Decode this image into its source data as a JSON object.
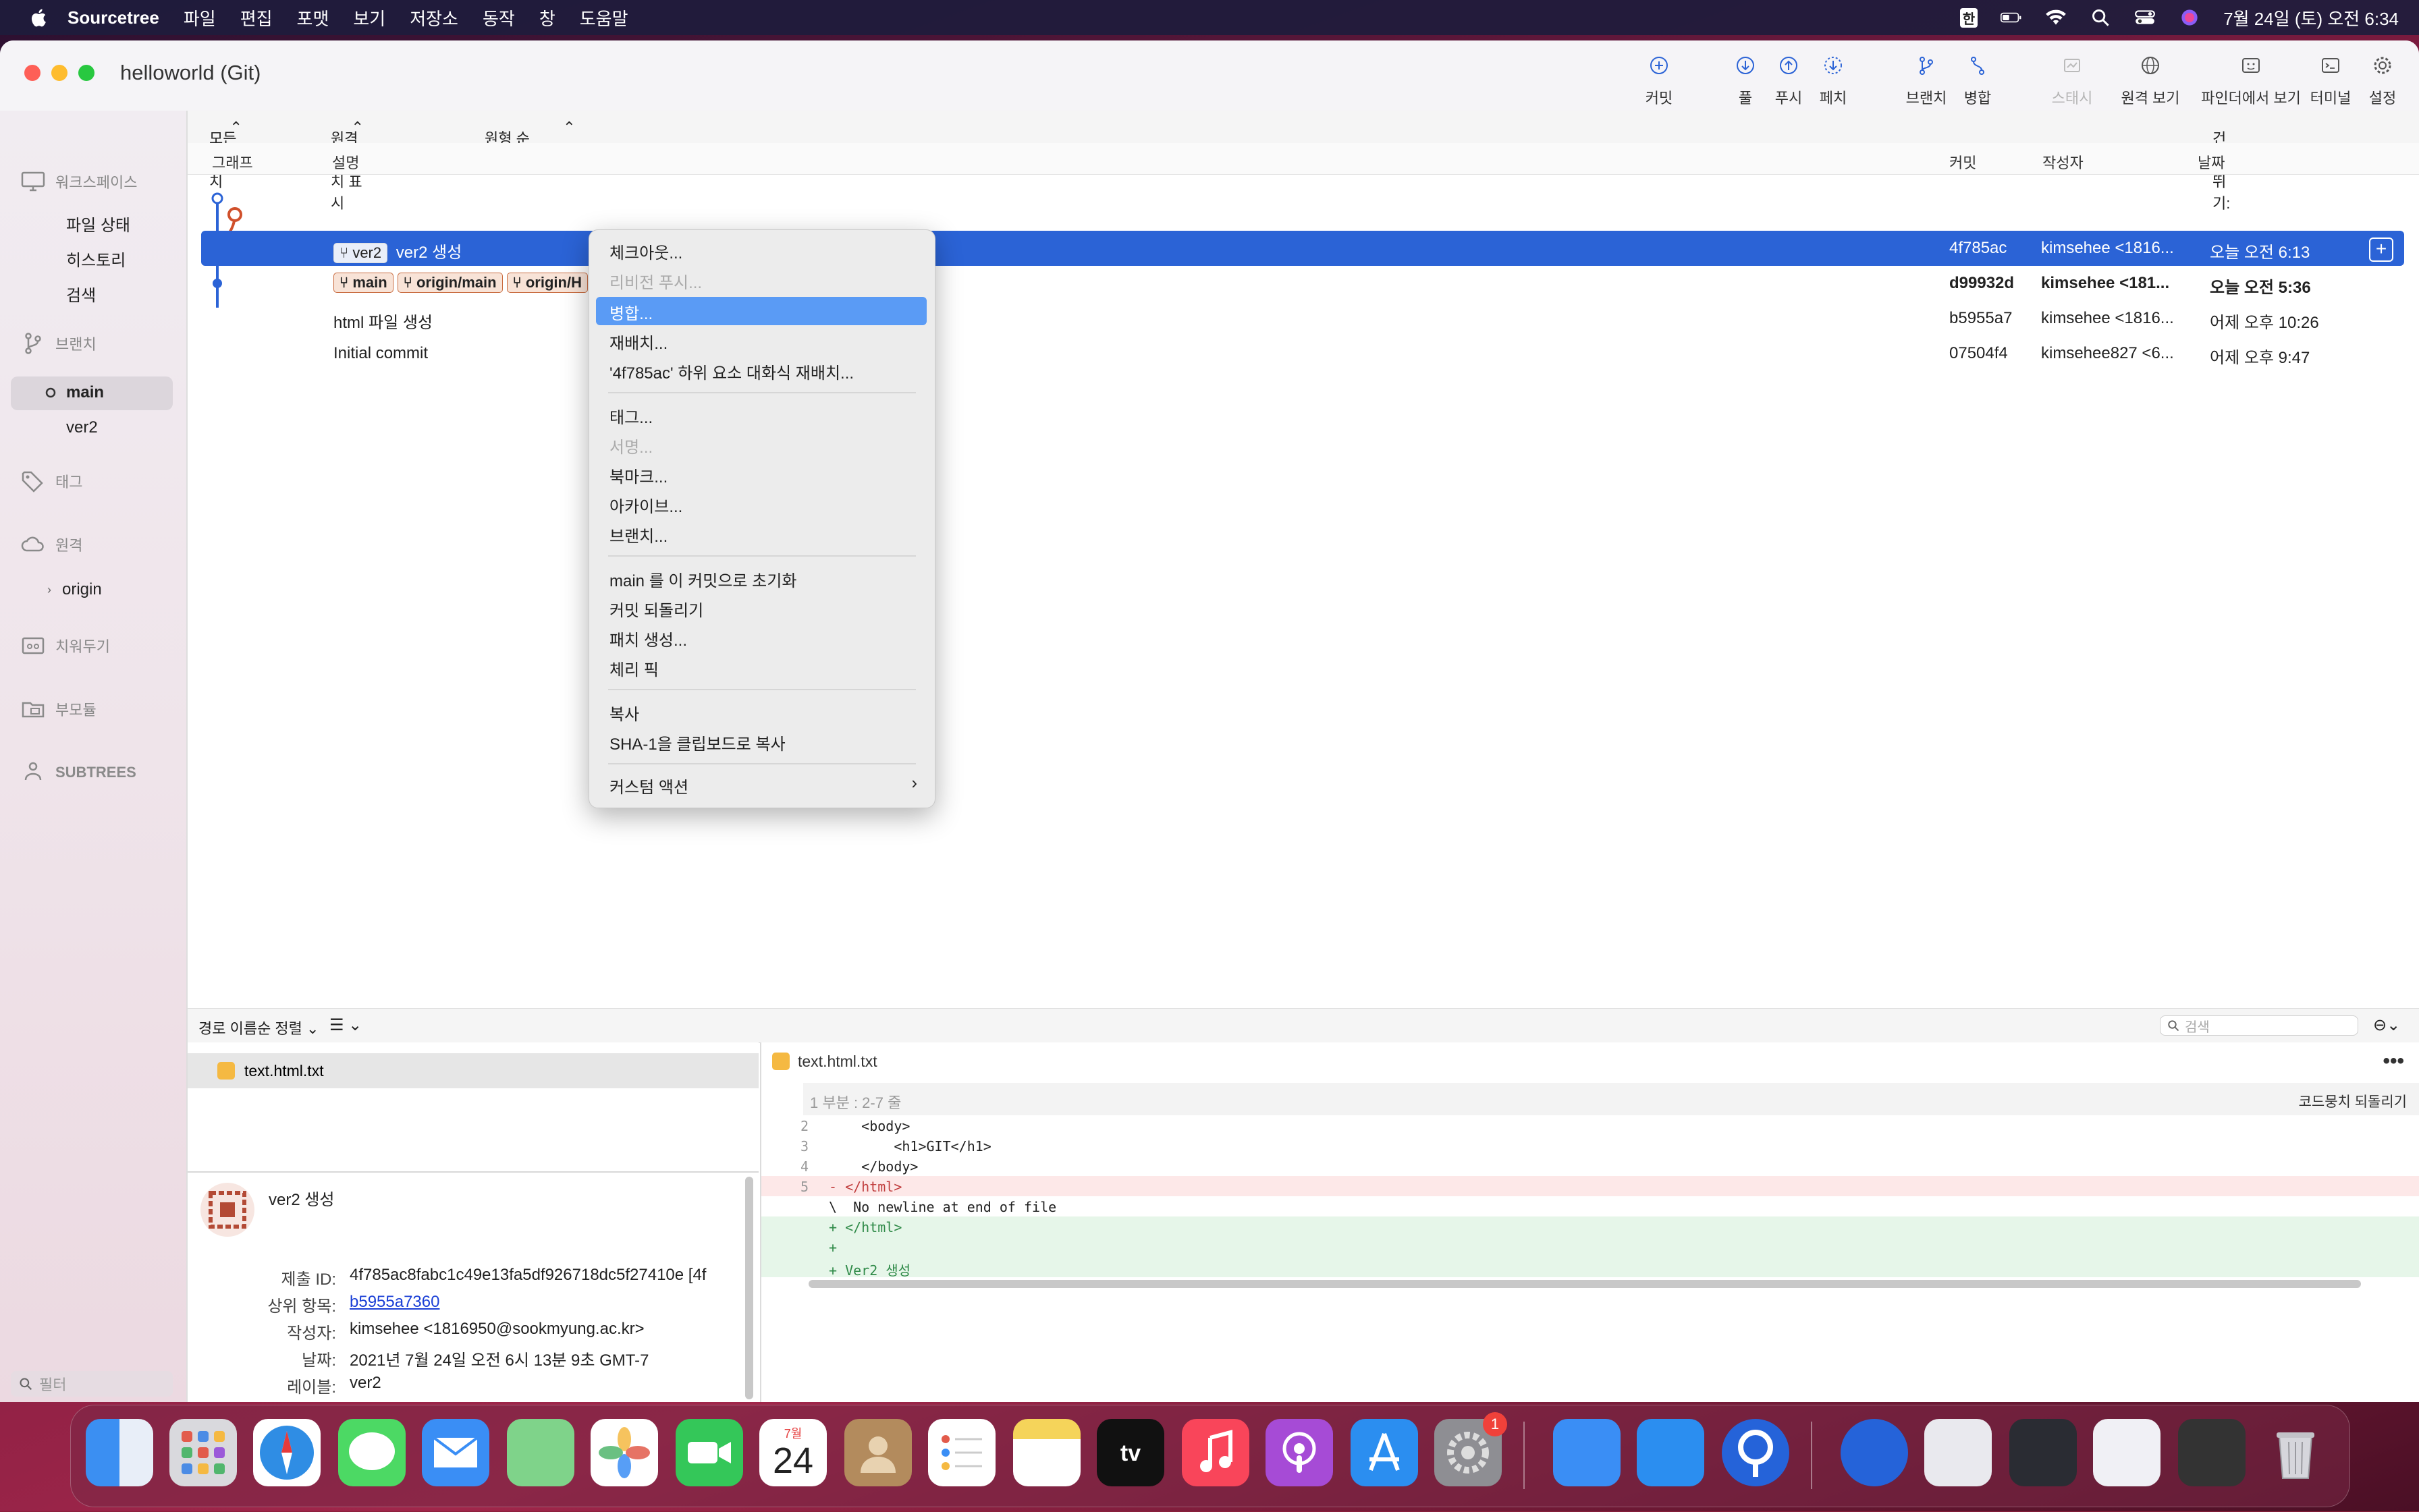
{
  "menubar": {
    "app": "Sourcetree",
    "items": [
      "파일",
      "편집",
      "포맷",
      "보기",
      "저장소",
      "동작",
      "창",
      "도움말"
    ],
    "input_method": "한",
    "clock": "7월 24일 (토) 오전 6:34"
  },
  "window": {
    "title": "helloworld (Git)",
    "toolbar": {
      "commit": "커밋",
      "pull": "풀",
      "push": "푸시",
      "fetch": "페치",
      "branch": "브랜치",
      "merge": "병합",
      "stash": "스태시",
      "remote": "원격 보기",
      "finder": "파인더에서 보기",
      "terminal": "터미널",
      "settings": "설정"
    }
  },
  "sidebar": {
    "workspace": "워크스페이스",
    "workspace_items": [
      "파일 상태",
      "히스토리",
      "검색"
    ],
    "branches": "브랜치",
    "branch_items": [
      "main",
      "ver2"
    ],
    "tags": "태그",
    "remotes": "원격",
    "remote_items": [
      "origin"
    ],
    "stashes": "치워두기",
    "submodules": "부모듈",
    "subtrees": "SUBTREES",
    "filter_placeholder": "필터"
  },
  "history": {
    "filter_all_branches": "모든 브랜치",
    "filter_show_remote": "원격 브랜치 표시",
    "filter_order": "원형 순",
    "jump_to": "건너뛰기:",
    "columns": {
      "graph": "그래프",
      "description": "설명",
      "commit": "커밋",
      "author": "작성자",
      "date": "날짜"
    },
    "rows": [
      {
        "tags": [
          "ver2"
        ],
        "description": "ver2 생성",
        "commit": "4f785ac",
        "author": "kimsehee <1816...",
        "date": "오늘 오전 6:13"
      },
      {
        "tags": [
          "main",
          "origin/main",
          "origin/H"
        ],
        "description": "",
        "commit": "d99932d",
        "author": "kimsehee <181...",
        "date": "오늘 오전 5:36"
      },
      {
        "tags": [],
        "description": "html 파일 생성",
        "commit": "b5955a7",
        "author": "kimsehee <1816...",
        "date": "어제 오후 10:26"
      },
      {
        "tags": [],
        "description": "Initial commit",
        "commit": "07504f4",
        "author": "kimsehee827 <6...",
        "date": "어제 오후 9:47"
      }
    ]
  },
  "context_menu": {
    "items": [
      "체크아웃...",
      "리비전 푸시...",
      "병합...",
      "재배치...",
      "'4f785ac' 하위 요소 대화식 재배치...",
      "태그...",
      "서명...",
      "북마크...",
      "아카이브...",
      "브랜치...",
      "main 를 이 커밋으로 초기화",
      "커밋 되돌리기",
      "패치 생성...",
      "체리 픽",
      "복사",
      "SHA-1을 클립보드로 복사",
      "커스텀 액션"
    ]
  },
  "lower": {
    "sort": "경로 이름순 정렬",
    "search_placeholder": "검색",
    "file": "text.html.txt",
    "commit_details": {
      "title": "ver2 생성",
      "id_label": "제출 ID:",
      "id": "4f785ac8fabc1c49e13fa5df926718dc5f27410e [4f",
      "parent_label": "상위 항목:",
      "parent": "b5955a7360",
      "author_label": "작성자:",
      "author": "kimsehee <1816950@sookmyung.ac.kr>",
      "date_label": "날짜:",
      "date": "2021년 7월 24일 오전 6시 13분 9초 GMT-7",
      "labels_label": "레이블:",
      "labels": "ver2"
    },
    "diff": {
      "file": "text.html.txt",
      "hunk": "1 부분 : 2-7 줄",
      "revert_hunk": "코드뭉치 되돌리기",
      "lines": [
        {
          "n": "2",
          "t": "    <body>",
          "k": "ctx"
        },
        {
          "n": "3",
          "t": "        <h1>GIT</h1>",
          "k": "ctx"
        },
        {
          "n": "4",
          "t": "    </body>",
          "k": "ctx"
        },
        {
          "n": "5",
          "t": "- </html>",
          "k": "del"
        },
        {
          "n": "",
          "t": "\\  No newline at end of file",
          "k": "ctx"
        },
        {
          "n": "",
          "t": "+ </html>",
          "k": "add"
        },
        {
          "n": "",
          "t": "+",
          "k": "add"
        },
        {
          "n": "",
          "t": "+ Ver2 생성",
          "k": "add"
        }
      ]
    }
  },
  "dock": {
    "calendar_month": "7월",
    "calendar_day": "24",
    "notification": "1"
  },
  "colors": {
    "selection": "#2b63d6",
    "menu_highlight": "#5a9bf5",
    "branch_red": "#d0502b",
    "branch_blue": "#2b63d6"
  }
}
